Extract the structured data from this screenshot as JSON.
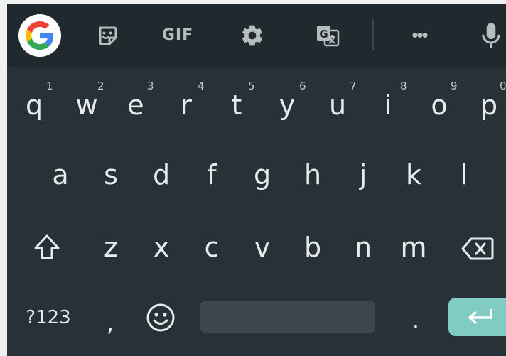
{
  "toolbar": {
    "gif_label": "GIF",
    "more_label": "•••"
  },
  "rows": {
    "row1": [
      {
        "letter": "q",
        "hint": "1"
      },
      {
        "letter": "w",
        "hint": "2"
      },
      {
        "letter": "e",
        "hint": "3"
      },
      {
        "letter": "r",
        "hint": "4"
      },
      {
        "letter": "t",
        "hint": "5"
      },
      {
        "letter": "y",
        "hint": "6"
      },
      {
        "letter": "u",
        "hint": "7"
      },
      {
        "letter": "i",
        "hint": "8"
      },
      {
        "letter": "o",
        "hint": "9"
      },
      {
        "letter": "p",
        "hint": "0"
      }
    ],
    "row2": [
      "a",
      "s",
      "d",
      "f",
      "g",
      "h",
      "j",
      "k",
      "l"
    ],
    "row3": [
      "z",
      "x",
      "c",
      "v",
      "b",
      "n",
      "m"
    ]
  },
  "bottom": {
    "symbols_label": "?123",
    "comma_label": ",",
    "period_label": "."
  },
  "colors": {
    "keyboard_bg": "#263238",
    "toolbar_bg": "#1f292e",
    "enter_bg": "#80cbc4",
    "space_bg": "#3b474c"
  }
}
